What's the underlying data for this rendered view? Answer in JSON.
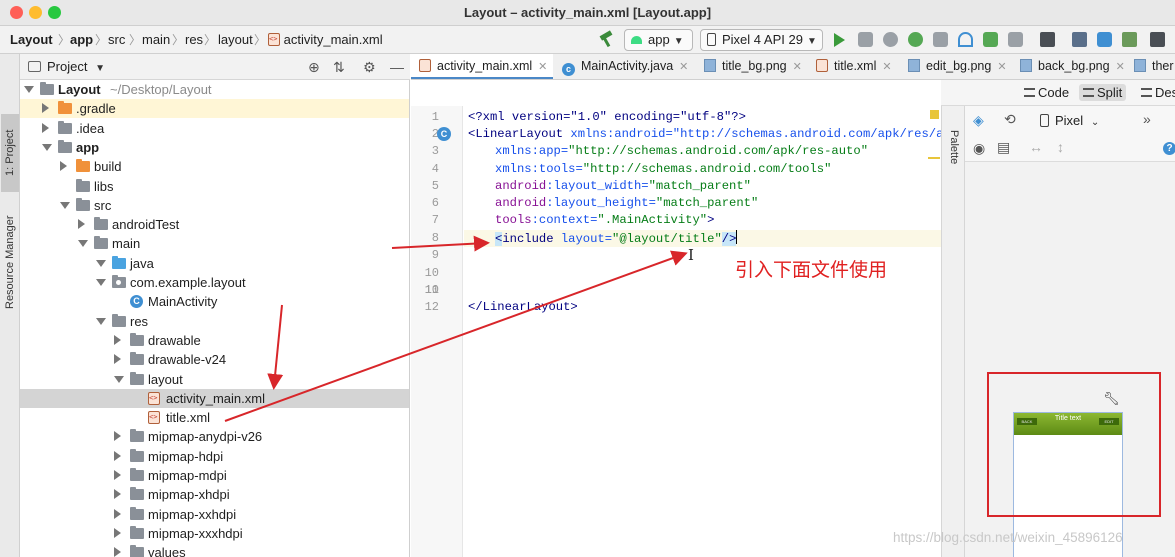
{
  "window": {
    "title": "Layout – activity_main.xml [Layout.app]"
  },
  "breadcrumb": [
    "Layout",
    "app",
    "src",
    "main",
    "res",
    "layout",
    "activity_main.xml"
  ],
  "toolbar": {
    "run_config": "app",
    "device": "Pixel 4 API 29",
    "accent": "#3a9a3a"
  },
  "sidebar": {
    "project_tab": "1: Project",
    "resource_tab": "Resource Manager"
  },
  "project_panel": {
    "title": "Project",
    "tree": [
      {
        "label": "Layout",
        "suffix": "~/Desktop/Layout",
        "icon": "folder",
        "arrow": "down",
        "bold": true
      },
      {
        "label": ".gradle",
        "icon": "folder-orange",
        "arrow": "right"
      },
      {
        "label": ".idea",
        "icon": "folder",
        "arrow": "right"
      },
      {
        "label": "app",
        "icon": "folder",
        "arrow": "down",
        "bold": true
      },
      {
        "label": "build",
        "icon": "folder-orange",
        "arrow": "right"
      },
      {
        "label": "libs",
        "icon": "folder",
        "arrow": "none"
      },
      {
        "label": "src",
        "icon": "folder",
        "arrow": "down"
      },
      {
        "label": "androidTest",
        "icon": "folder",
        "arrow": "right"
      },
      {
        "label": "main",
        "icon": "folder",
        "arrow": "down"
      },
      {
        "label": "java",
        "icon": "folder-blue",
        "arrow": "down"
      },
      {
        "label": "com.example.layout",
        "icon": "package",
        "arrow": "down"
      },
      {
        "label": "MainActivity",
        "icon": "class",
        "arrow": "none"
      },
      {
        "label": "res",
        "icon": "folder",
        "arrow": "down"
      },
      {
        "label": "drawable",
        "icon": "folder",
        "arrow": "right"
      },
      {
        "label": "drawable-v24",
        "icon": "folder",
        "arrow": "right"
      },
      {
        "label": "layout",
        "icon": "folder",
        "arrow": "down"
      },
      {
        "label": "activity_main.xml",
        "icon": "xml",
        "arrow": "none",
        "selected": true
      },
      {
        "label": "title.xml",
        "icon": "xml",
        "arrow": "none"
      },
      {
        "label": "mipmap-anydpi-v26",
        "icon": "folder",
        "arrow": "right"
      },
      {
        "label": "mipmap-hdpi",
        "icon": "folder",
        "arrow": "right"
      },
      {
        "label": "mipmap-mdpi",
        "icon": "folder",
        "arrow": "right"
      },
      {
        "label": "mipmap-xhdpi",
        "icon": "folder",
        "arrow": "right"
      },
      {
        "label": "mipmap-xxhdpi",
        "icon": "folder",
        "arrow": "right"
      },
      {
        "label": "mipmap-xxxhdpi",
        "icon": "folder",
        "arrow": "right"
      },
      {
        "label": "values",
        "icon": "folder",
        "arrow": "right"
      }
    ]
  },
  "editor": {
    "tabs": [
      {
        "label": "activity_main.xml",
        "icon": "xml",
        "active": true
      },
      {
        "label": "MainActivity.java",
        "icon": "class"
      },
      {
        "label": "title_bg.png",
        "icon": "image"
      },
      {
        "label": "title.xml",
        "icon": "xml"
      },
      {
        "label": "edit_bg.png",
        "icon": "image"
      },
      {
        "label": "back_bg.png",
        "icon": "image"
      },
      {
        "label": "ther",
        "icon": "image"
      }
    ],
    "modes": {
      "code": "Code",
      "split": "Split",
      "design": "Des"
    },
    "line_numbers": [
      "1",
      "2",
      "3",
      "4",
      "5",
      "6",
      "7",
      "8",
      "9",
      "10",
      "11",
      "12"
    ],
    "code": {
      "l1": "<?xml version=\"1.0\" encoding=\"utf-8\"?>",
      "l2_tag": "<LinearLayout",
      "l2_rest": " xmlns:android=\"http://schemas.android.com/apk/res/android\"",
      "l3_attr": "xmlns:app=",
      "l3_val": "\"http://schemas.android.com/apk/res-auto\"",
      "l4_attr": "xmlns:tools=",
      "l4_val": "\"http://schemas.android.com/tools\"",
      "l5_ns": "android",
      "l5_attr": ":layout_width=",
      "l5_val": "\"match_parent\"",
      "l6_ns": "android",
      "l6_attr": ":layout_height=",
      "l6_val": "\"match_parent\"",
      "l7_ns": "tools",
      "l7_attr": ":context=",
      "l7_val": "\".MainActivity\"",
      "l7_end": ">",
      "l8_open": "<",
      "l8_tag": "include",
      "l8_attr": " layout=",
      "l8_val": "\"@layout/title\"",
      "l8_end": "/>",
      "l12": "</LinearLayout>"
    }
  },
  "palette": {
    "label": "Palette"
  },
  "design_panel": {
    "device": "Pixel",
    "preview_title": "Title text",
    "preview_back": "BACK",
    "preview_edit": "EDIT"
  },
  "annotation": {
    "note": "引入下面文件使用",
    "color": "#d8262a"
  },
  "watermark": "https://blog.csdn.net/weixin_45896126"
}
